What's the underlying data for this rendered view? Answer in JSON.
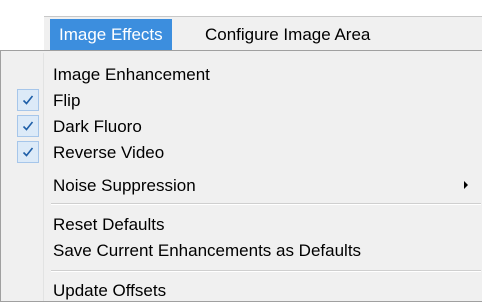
{
  "menubar": {
    "items": [
      {
        "label": "Image Effects",
        "active": true
      },
      {
        "label": "Configure Image Area",
        "active": false
      }
    ]
  },
  "menu": {
    "items": [
      {
        "label": "Image Enhancement",
        "checked": false
      },
      {
        "label": "Flip",
        "checked": true
      },
      {
        "label": "Dark Fluoro",
        "checked": true
      },
      {
        "label": "Reverse Video",
        "checked": true
      },
      {
        "label": "Noise Suppression",
        "checked": false,
        "has_submenu": true
      },
      {
        "label": "Reset Defaults",
        "checked": false
      },
      {
        "label": "Save Current Enhancements as Defaults",
        "checked": false
      },
      {
        "label": "Update Offsets",
        "checked": false
      }
    ]
  },
  "colors": {
    "active_menu_bg": "#3c8ede",
    "active_menu_text": "#ffffff",
    "menu_bg": "#f0f0f0",
    "check_box_bg": "#dceaf8",
    "check_box_border": "#a6c6ea",
    "check_mark": "#1f5fa8"
  },
  "icons": {
    "check": "check-icon",
    "submenu": "submenu-arrow-icon"
  }
}
